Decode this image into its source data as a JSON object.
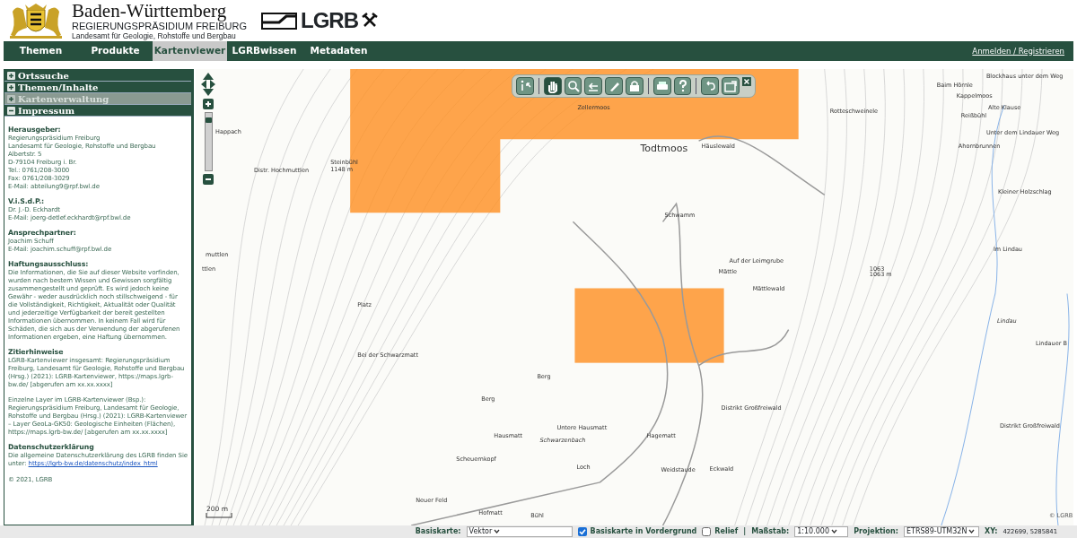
{
  "header": {
    "state": "Baden-Württemberg",
    "authority": "REGIERUNGSPRÄSIDIUM FREIBURG",
    "agency": "Landesamt für Geologie, Rohstoffe und Bergbau",
    "logo_text": "LGRB"
  },
  "nav": {
    "tabs": [
      {
        "label": "Themen",
        "selected": false
      },
      {
        "label": "Produkte",
        "selected": false
      },
      {
        "label": "Kartenviewer",
        "selected": true
      },
      {
        "label": "LGRBwissen",
        "selected": false
      },
      {
        "label": "Metadaten",
        "selected": false
      }
    ],
    "login": "Anmelden / Registrieren"
  },
  "sidebar": {
    "sections": [
      {
        "title": "Ortssuche",
        "expanded": false,
        "disabled": false
      },
      {
        "title": "Themen/Inhalte",
        "expanded": false,
        "disabled": false
      },
      {
        "title": "Kartenverwaltung",
        "expanded": false,
        "disabled": true
      },
      {
        "title": "Impressum",
        "expanded": true,
        "disabled": false
      }
    ],
    "impressum": [
      {
        "heading": "Herausgeber:",
        "lines": [
          "Regierungspräsidium Freiburg",
          "Landesamt für Geologie, Rohstoffe und Bergbau",
          "Albertstr. 5",
          "D-79104 Freiburg i. Br.",
          "Tel.: 0761/208-3000",
          "Fax: 0761/208-3029",
          "E-Mail: abteilung9@rpf.bwl.de"
        ]
      },
      {
        "heading": "V.i.S.d.P.:",
        "lines": [
          "Dr. J.-D. Eckhardt",
          "E-Mail: joerg-detlef.eckhardt@rpf.bwl.de"
        ]
      },
      {
        "heading": "Ansprechpartner:",
        "lines": [
          "Joachim Schuff",
          "E-Mail: joachim.schuff@rpf.bwl.de"
        ]
      },
      {
        "heading": "Haftungsausschluss:",
        "lines": [
          "Die Informationen, die Sie auf dieser Website vorfinden, wurden nach bestem Wissen und Gewissen sorgfältig zusammengestellt und geprüft. Es wird jedoch keine Gewähr - weder ausdrücklich noch stillschweigend - für die Vollständigkeit, Richtigkeit, Aktualität oder Qualität und jederzeitige Verfügbarkeit der bereit gestellten Informationen übernommen. In keinem Fall wird für Schäden, die sich aus der Verwendung der abgerufenen Informationen ergeben, eine Haftung übernommen."
        ]
      },
      {
        "heading": "Zitierhinweise",
        "lines": [
          "LGRB-Kartenviewer insgesamt: Regierungspräsidium Freiburg, Landesamt für Geologie, Rohstoffe und Bergbau (Hrsg.) (2021): LGRB-Kartenviewer, https://maps.lgrb-bw.de/ [abgerufen am xx.xx.xxxx]",
          "Einzelne Layer im LGRB-Kartenviewer (Bsp.): Regierungspräsidium Freiburg, Landesamt für Geologie, Rohstoffe und Bergbau (Hrsg.) (2021): LGRB-Kartenviewer – Layer GeoLa-GK50: Geologische Einheiten (Flächen), https://maps.lgrb-bw.de/ [abgerufen am xx.xx.xxxx]"
        ]
      },
      {
        "heading": "Datenschutzerklärung",
        "lines": [
          "Die allgemeine Datenschutzerklärung des LGRB finden Sie unter:"
        ],
        "link": "https://lgrb-bw.de/datenschutz/index_html"
      }
    ],
    "copyright": "© 2021, LGRB"
  },
  "map": {
    "zoom": {
      "level": 0.92
    },
    "toolbar": [
      {
        "kind": "info",
        "selected": false
      },
      {
        "kind": "pan",
        "selected": true
      },
      {
        "kind": "zoom",
        "selected": false
      },
      {
        "kind": "back",
        "selected": false
      },
      {
        "kind": "draw",
        "selected": false
      },
      {
        "kind": "lock",
        "selected": false
      },
      {
        "kind": "print",
        "selected": false
      },
      {
        "kind": "help",
        "selected": false
      },
      {
        "kind": "undo",
        "selected": false
      },
      {
        "kind": "export",
        "selected": false
      }
    ],
    "labels": [
      "Zellermoos",
      "Blockhaus unter dem Weg",
      "Baim Hörnle",
      "Kappelmoos",
      "Alte Klause",
      "Rotteschweinele",
      "Reißbühl",
      "Ahornbrunnen",
      "Unter dem Lindauer Weg",
      "Todtmoos",
      "Häuslewald",
      "Happach",
      "Steinbühl",
      "1148 m",
      "Distr. Hochmuttlen",
      "Kleiner Holzschlag",
      "Schwamm",
      "Auf der Leimgrube",
      "Mättle",
      "Im Lindau",
      "1063",
      "1063 m",
      "Mättlewald",
      "Platz",
      "Lindau",
      "Lindauer B",
      "Bei der Schwarzmatt",
      "Berg",
      "Berg",
      "Distrikt Großfreiwald",
      "Untere Hausmatt",
      "Hausmatt",
      "Schwarzenbach",
      "Hagematt",
      "Distrikt Großfreiwald",
      "Scheuernkopf",
      "Loch",
      "Weidstaude",
      "Eckwald",
      "Neuer Feld",
      "Hofmatt",
      "Bühl",
      "muttlen",
      "ttlen"
    ],
    "scale": "200 m",
    "credit": "© LGRB"
  },
  "status_bar": {
    "basemap_label": "Basiskarte:",
    "basemap": "Vektor",
    "foreground": {
      "label": "Basiskarte in Vordergrund",
      "checked": true
    },
    "relief": {
      "label": "Relief",
      "checked": false
    },
    "separator": "|",
    "scale_label": "Maßstab:",
    "scale": "1:10.000",
    "projection_label": "Projektion:",
    "projection": "ETRS89-UTM32N",
    "xy_label": "XY:",
    "xy": "422699, 5285841"
  }
}
